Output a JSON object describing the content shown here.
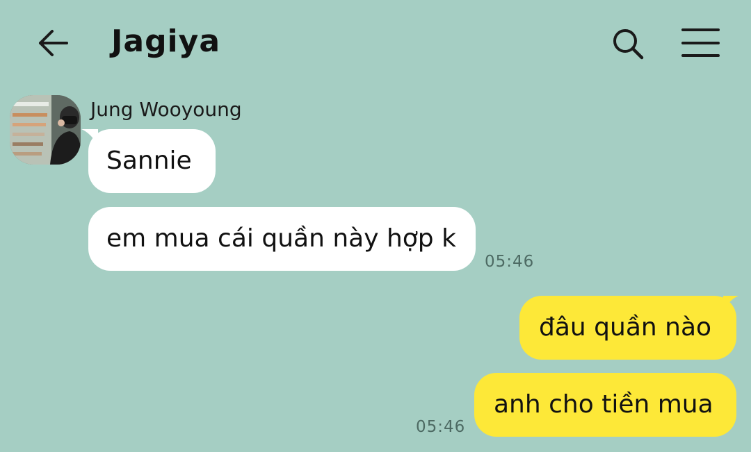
{
  "header": {
    "title": "Jagiya",
    "back_icon": "arrow-left-icon",
    "search_icon": "search-icon",
    "menu_icon": "menu-icon"
  },
  "contact": {
    "name": "Jung Wooyoung"
  },
  "messages": [
    {
      "direction": "incoming",
      "text": "Sannie",
      "time": ""
    },
    {
      "direction": "incoming",
      "text": "em mua cái quần này hợp k",
      "time": "05:46"
    },
    {
      "direction": "outgoing",
      "text": "đâu quần nào",
      "time": ""
    },
    {
      "direction": "outgoing",
      "text": "anh cho tiền mua",
      "time": "05:46"
    }
  ],
  "colors": {
    "background": "#a5cec3",
    "incoming_bubble": "#ffffff",
    "outgoing_bubble": "#fde838",
    "timestamp": "#4d6a63"
  }
}
